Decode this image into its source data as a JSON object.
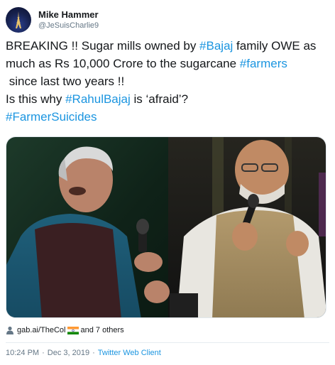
{
  "tweet": {
    "author": {
      "name": "Mike Hammer",
      "handle": "@JeSuisCharlie9",
      "avatar_icon": "eiffel-tower-icon"
    },
    "text_lines": [
      [
        {
          "t": "BREAKING !! Sugar mills owned by "
        },
        {
          "t": "#Bajaj",
          "tag": true
        },
        {
          "t": " family OWE as"
        }
      ],
      [
        {
          "t": "much as Rs 10,000 Crore to the sugarcane "
        },
        {
          "t": "#farmers",
          "tag": true
        }
      ],
      [
        {
          "t": " since last two years !!"
        }
      ],
      [
        {
          "t": "Is this why "
        },
        {
          "t": "#RahulBajaj",
          "tag": true
        },
        {
          "t": " is ‘afraid’?"
        }
      ],
      [
        {
          "t": "#FarmerSuicides",
          "tag": true
        }
      ]
    ],
    "media": {
      "type": "photo",
      "description_icon": "photo-two-men-on-stage"
    },
    "social_context": {
      "icon": "person-icon",
      "tagged_user": "gab.ai/TheCol",
      "flag_icon": "india-flag-icon",
      "others": "and 7 others"
    },
    "meta": {
      "time": "10:24 PM",
      "date": "Dec 3, 2019",
      "separator": "·",
      "client": "Twitter Web Client"
    },
    "colors": {
      "link": "#1b95e0",
      "secondary": "#657786",
      "text": "#14171a"
    }
  }
}
